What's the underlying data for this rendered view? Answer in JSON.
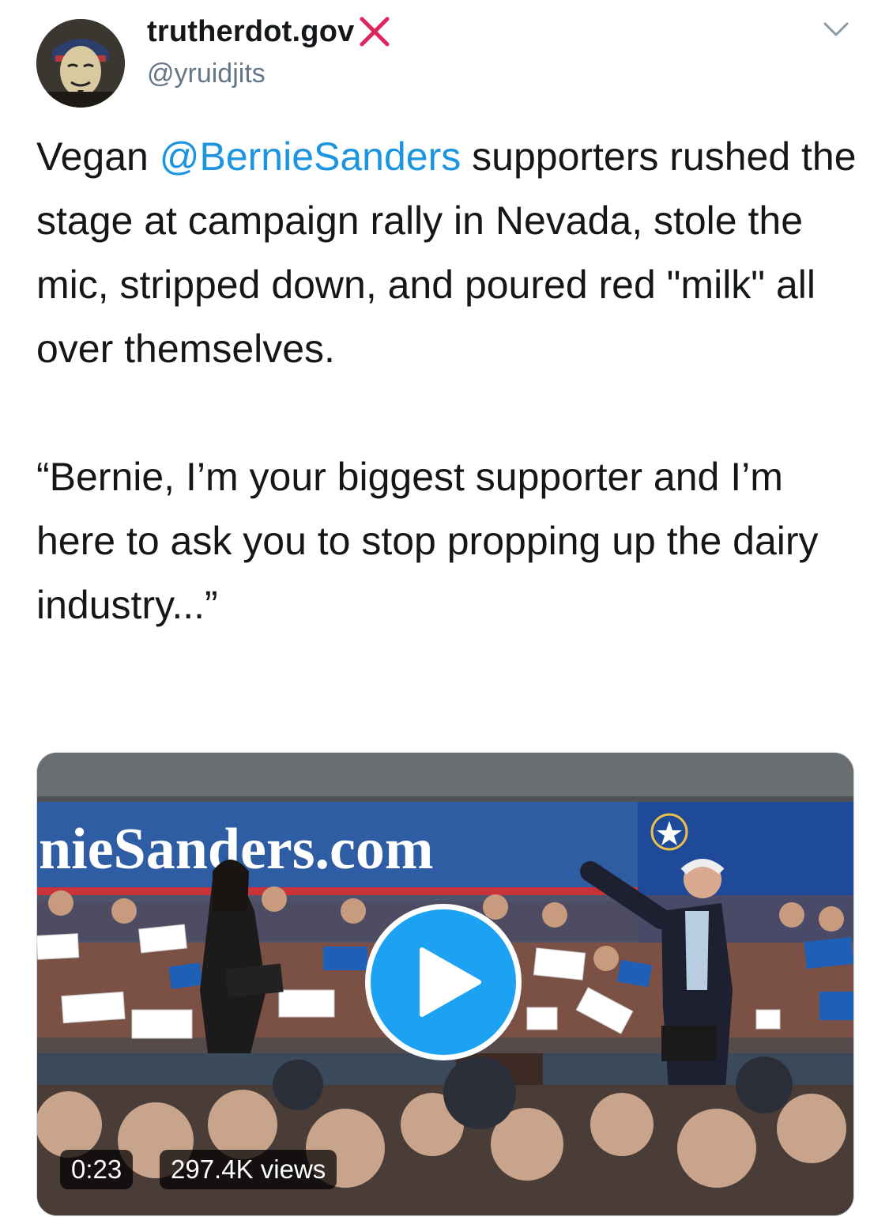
{
  "author": {
    "display_name": "trutherdot.gov",
    "handle": "@yruidjits",
    "avatar_icon": "masked-face-avatar",
    "badge_icon": "red-x-icon"
  },
  "tweet": {
    "text_before_mention": "Vegan ",
    "mention": "@BernieSanders",
    "text_after_mention": " supporters rushed the stage at campaign rally in Nevada, stole the mic, stripped down, and poured red \"milk\" all over themselves.\n\n“Bernie, I’m your biggest supporter and I’m here to ask you to stop propping up the dairy industry...”"
  },
  "media": {
    "type": "video",
    "banner_text": "nieSanders.com",
    "duration": "0:23",
    "views": "297.4K views",
    "play_icon": "play-icon"
  },
  "colors": {
    "link": "#1b95e0",
    "play_button": "#1da1f2",
    "badge_x": "#e0245e"
  }
}
